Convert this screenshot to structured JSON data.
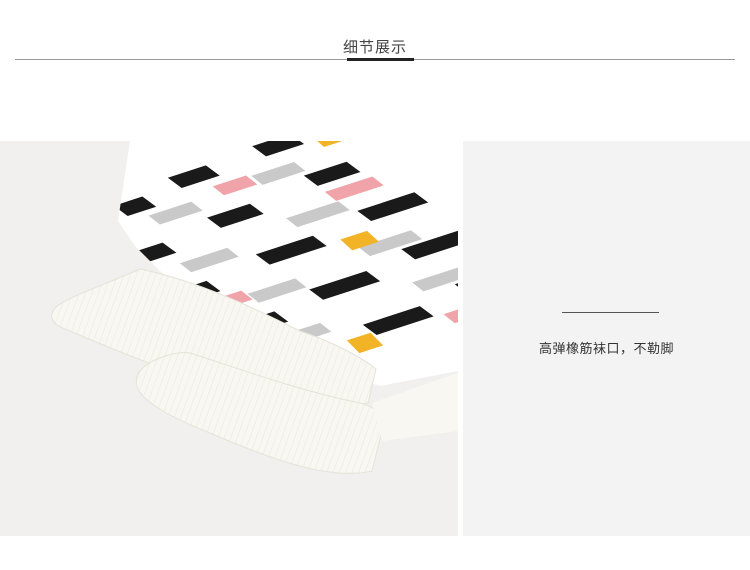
{
  "header": {
    "title": "细节展示"
  },
  "detail": {
    "caption": "高弹橡筋袜口，不勒脚",
    "image_subject": "sock-cuff-detail"
  },
  "colors": {
    "cuff": "#f8f7f1",
    "stripe_black": "#1a1a1a",
    "stripe_gray": "#c9c9c9",
    "stripe_pink": "#f0a3a8",
    "stripe_yellow": "#f2b327",
    "panel_bg": "#f1f0ee"
  }
}
